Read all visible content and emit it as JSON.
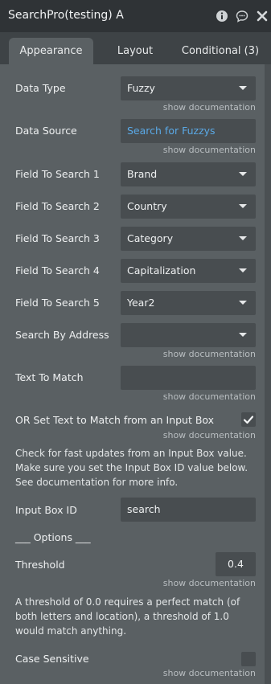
{
  "header": {
    "title": "SearchPro(testing) A"
  },
  "tabs": [
    {
      "label": "Appearance"
    },
    {
      "label": "Layout"
    },
    {
      "label": "Conditional (3)"
    }
  ],
  "fields": {
    "data_type": {
      "label": "Data Type",
      "value": "Fuzzy",
      "doc": "show documentation"
    },
    "data_source": {
      "label": "Data Source",
      "value": "Search for Fuzzys",
      "doc": "show documentation"
    },
    "field1": {
      "label": "Field To Search 1",
      "value": "Brand"
    },
    "field2": {
      "label": "Field To Search 2",
      "value": "Country"
    },
    "field3": {
      "label": "Field To Search 3",
      "value": "Category"
    },
    "field4": {
      "label": "Field To Search 4",
      "value": "Capitalization"
    },
    "field5": {
      "label": "Field To Search 5",
      "value": "Year2"
    },
    "search_by_address": {
      "label": "Search By Address",
      "value": "",
      "doc": "show documentation"
    },
    "text_to_match": {
      "label": "Text To Match",
      "value": "",
      "doc": "show documentation"
    },
    "or_set_text": {
      "label": "OR Set Text to Match from an Input Box",
      "checked": true,
      "doc": "show documentation"
    },
    "input_box_help": "Check for fast updates from an Input Box value. Make sure you set the Input Box ID value below. See documentation for more info.",
    "input_box_id": {
      "label": "Input Box ID",
      "value": "search"
    },
    "options_header": "___ Options ___",
    "threshold": {
      "label": "Threshold",
      "value": "0.4",
      "doc": "show documentation"
    },
    "threshold_help": "A threshold of 0.0 requires a perfect match (of both letters and location), a threshold of 1.0 would match anything.",
    "case_sensitive": {
      "label": "Case Sensitive",
      "checked": false,
      "doc": "show documentation"
    }
  },
  "icons": {
    "info": "info-icon",
    "comment": "comment-icon",
    "close": "close-icon",
    "dropdown": "chevron-down-icon",
    "check": "check-icon"
  },
  "colors": {
    "panel_bg": "#5a6063",
    "title_bg": "#2f3336",
    "field_bg": "#484d50",
    "link": "#5aa9e6"
  }
}
